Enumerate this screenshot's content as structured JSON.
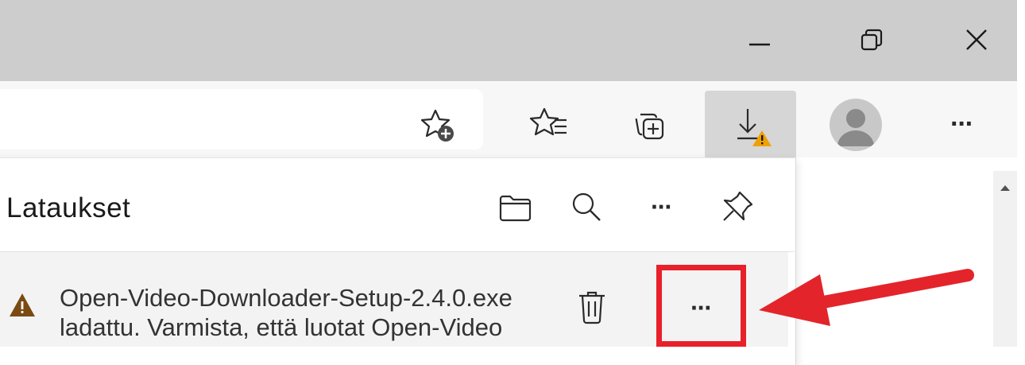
{
  "window_controls": {
    "minimize_icon": "minimize-icon",
    "restore_icon": "restore-icon",
    "close_icon": "close-icon"
  },
  "toolbar": {
    "icons": [
      "add-favorite-icon",
      "favorites-icon",
      "collections-icon",
      "downloads-warning-icon",
      "profile-avatar",
      "more-icon"
    ],
    "more_label": "···"
  },
  "downloads_panel": {
    "title": "Lataukset",
    "header_icons": [
      "folder-icon",
      "search-icon",
      "more-icon",
      "pin-icon"
    ],
    "header_more_label": "···",
    "item": {
      "line1": "Open-Video-Downloader-Setup-2.4.0.exe",
      "line2": "ladattu. Varmista, että luotat Open-Video",
      "more_label": "···"
    }
  },
  "colors": {
    "titlebar": "#cdcdcd",
    "toolbar": "#f7f7f7",
    "warning": "#f0a000",
    "highlight": "#e8202a",
    "arrow": "#e3242b"
  }
}
